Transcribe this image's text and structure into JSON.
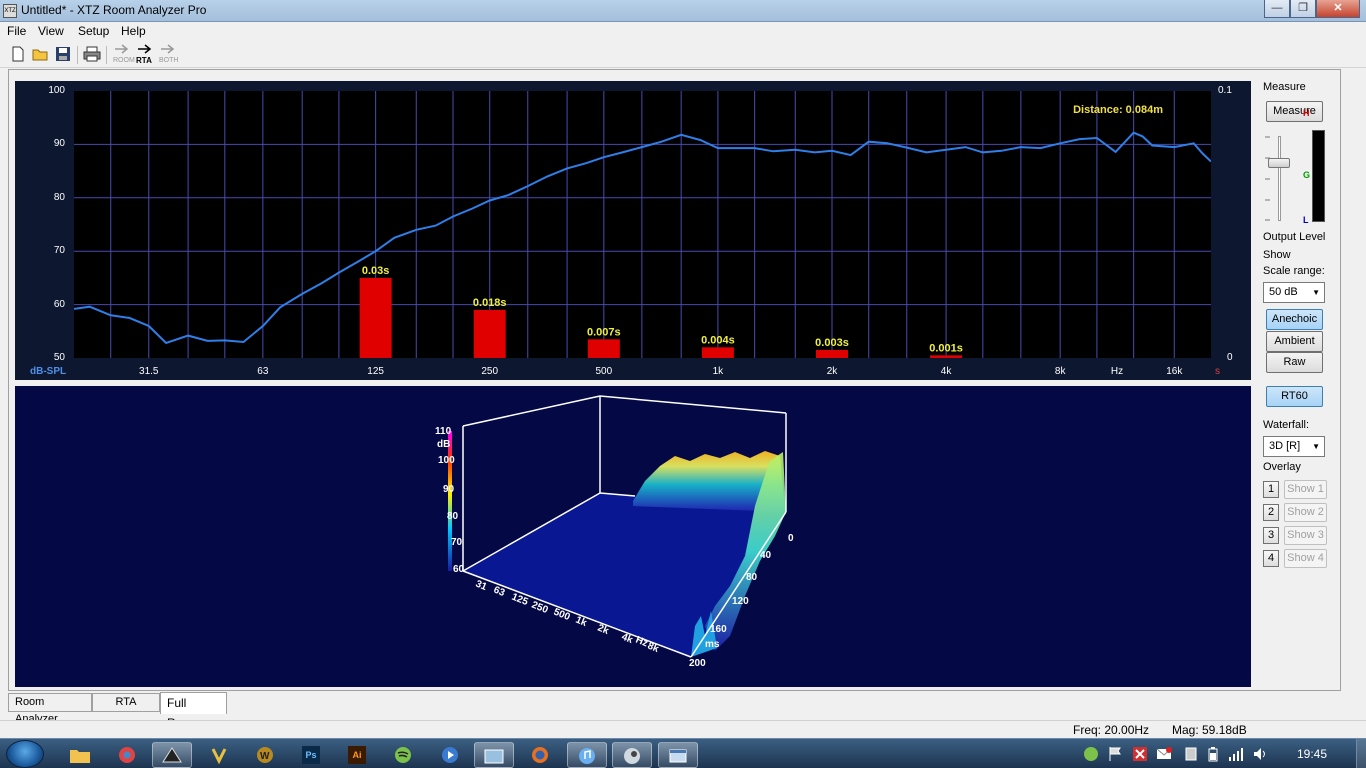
{
  "window": {
    "title": "Untitled* - XTZ Room Analyzer Pro",
    "app_icon_text": "XTZ",
    "minimize": "—",
    "maximize": "❐",
    "close": "✕"
  },
  "menu": [
    "File",
    "View",
    "Setup",
    "Help"
  ],
  "toolbar": {
    "new": "new-file-icon",
    "open": "open-folder-icon",
    "save": "save-icon",
    "print": "print-icon",
    "room_label": "ROOM",
    "rta_label": "RTA",
    "both_label": "BOTH"
  },
  "top_chart": {
    "distance_text": "Distance: 0.084m",
    "y_left_ticks": [
      "100",
      "90",
      "80",
      "70",
      "60",
      "50"
    ],
    "y_right_ticks": [
      "0.1",
      "0"
    ],
    "x_ticks": [
      "31.5",
      "63",
      "125",
      "250",
      "500",
      "1k",
      "2k",
      "4k",
      "8k",
      "Hz",
      "16k"
    ],
    "y_left_unit": "dB-SPL",
    "y_right_unit": "s",
    "line_color": "#2f7fe8",
    "bar_color": "#e00000"
  },
  "chart_data": {
    "type": "line",
    "xlabel": "Hz",
    "ylabel": "dB-SPL",
    "x_scale": "log",
    "xlim": [
      20,
      20000
    ],
    "ylim": [
      50,
      100
    ],
    "series": [
      {
        "x": [
          20,
          22,
          25,
          28,
          31.5,
          35,
          40,
          45,
          50,
          56,
          63,
          70,
          80,
          90,
          100,
          112,
          125,
          140,
          160,
          180,
          200,
          225,
          250,
          280,
          315,
          355,
          400,
          450,
          500,
          560,
          630,
          710,
          800,
          900,
          1000,
          1120,
          1250,
          1400,
          1600,
          1800,
          2000,
          2240,
          2500,
          2800,
          3150,
          3550,
          4000,
          4500,
          5000,
          5600,
          6300,
          7100,
          8000,
          9000,
          10000,
          11200,
          12500,
          13200,
          14000,
          16000,
          18000,
          19000,
          20000
        ],
        "y": [
          59.2,
          59.6,
          58,
          57.5,
          56,
          52.8,
          54.2,
          53.2,
          53.3,
          53,
          56,
          59.5,
          62,
          64,
          66,
          68,
          70,
          72.5,
          74,
          74.8,
          76.5,
          78,
          79.5,
          80.5,
          82.2,
          84,
          85.5,
          86.5,
          87.6,
          88.5,
          89.5,
          90.5,
          91.8,
          90.8,
          89.3,
          89.3,
          89.3,
          88.7,
          89,
          88.5,
          88.8,
          88,
          90.5,
          90.2,
          89.4,
          88.5,
          89,
          89.5,
          88.5,
          88.8,
          89.5,
          89.3,
          90.2,
          91,
          91.2,
          88.6,
          92.2,
          91.5,
          89.8,
          89.5,
          90.2,
          88.3,
          86.8
        ]
      }
    ],
    "rt60_bars": {
      "type": "bar",
      "categories": [
        "125",
        "250",
        "500",
        "1k",
        "2k",
        "4k"
      ],
      "values": [
        0.03,
        0.018,
        0.007,
        0.004,
        0.003,
        0.001
      ],
      "labels": [
        "0.03s",
        "0.018s",
        "0.007s",
        "0.004s",
        "0.003s",
        "0.001s"
      ],
      "ylim": [
        0,
        0.1
      ]
    }
  },
  "waterfall": {
    "z_ticks": [
      "110",
      "100",
      "90",
      "80",
      "70",
      "60"
    ],
    "z_unit": "dB",
    "freq_ticks": [
      "31",
      "63",
      "125",
      "250",
      "500",
      "1k",
      "2k",
      "4k",
      "8k"
    ],
    "freq_unit": "Hz",
    "time_ticks": [
      "0",
      "40",
      "80",
      "120",
      "160",
      "200"
    ],
    "time_unit": "ms"
  },
  "side": {
    "measure_title": "Measure",
    "measure_button": "Measure",
    "output_level_label": "Output Level",
    "meter_h": "H",
    "meter_g": "G",
    "meter_l": "L",
    "show_title": "Show",
    "scale_range_label": "Scale range:",
    "scale_range_value": "50 dB",
    "anechoic": "Anechoic",
    "ambient": "Ambient",
    "raw": "Raw",
    "rt60": "RT60",
    "waterfall_label": "Waterfall:",
    "waterfall_value": "3D [R]",
    "overlay_title": "Overlay",
    "overlays": [
      {
        "num": "1",
        "label": "Show 1"
      },
      {
        "num": "2",
        "label": "Show 2"
      },
      {
        "num": "3",
        "label": "Show 3"
      },
      {
        "num": "4",
        "label": "Show 4"
      }
    ]
  },
  "tabs": [
    "Room Analyzer",
    "RTA",
    "Full Range"
  ],
  "status": {
    "freq": "Freq: 20.00Hz",
    "mag": "Mag: 59.18dB"
  },
  "taskbar": {
    "clock": "19:45",
    "apps": [
      "folder-icon",
      "chrome-icon",
      "xtz-icon",
      "winamp-icon",
      "wow-icon",
      "photoshop-icon",
      "illustrator-icon",
      "spotify-icon",
      "media-icon",
      "explorer-icon",
      "firefox-icon",
      "itunes-icon",
      "steam-icon",
      "window-icon"
    ],
    "ps_text": "Ps",
    "ai_text": "Ai"
  }
}
